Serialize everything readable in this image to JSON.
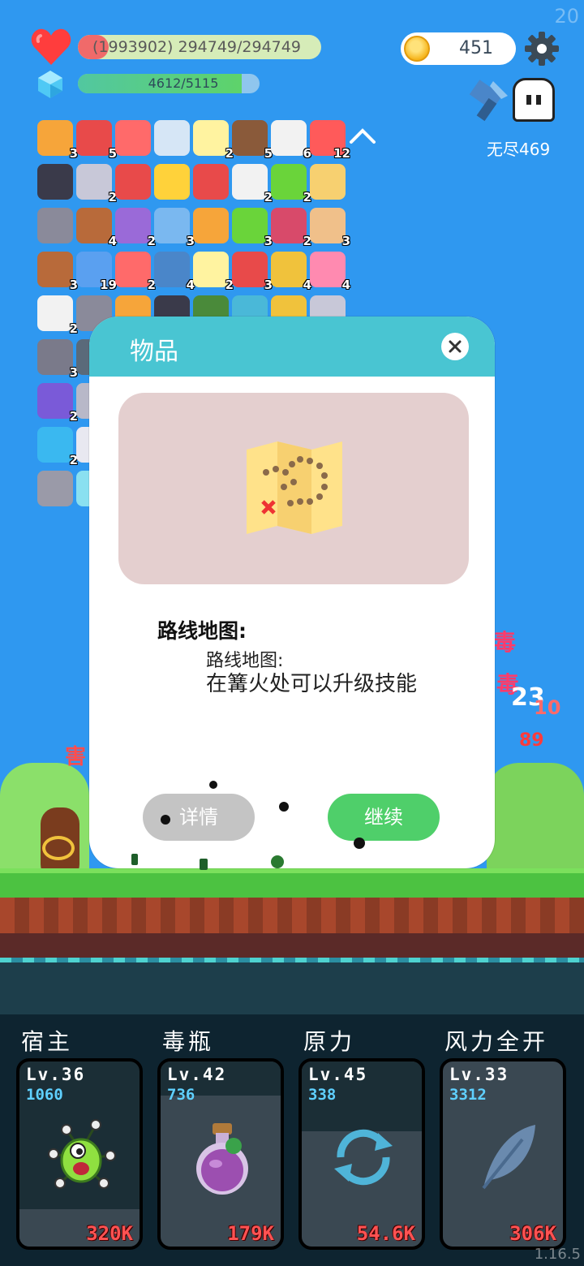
{
  "hud": {
    "fps": "20",
    "hp_text": "(1993902) 294749/294749",
    "mp_text": "4612/5115",
    "mp_fraction": 0.9,
    "coins": "451",
    "mode_label": "无尽469"
  },
  "items": [
    {
      "icon": "book-icon",
      "count": "3"
    },
    {
      "icon": "sock-icon",
      "count": "5"
    },
    {
      "icon": "percent-tag-icon",
      "count": ""
    },
    {
      "icon": "sword-icon",
      "count": ""
    },
    {
      "icon": "flower-icon",
      "count": "2"
    },
    {
      "icon": "coconut-icon",
      "count": "5"
    },
    {
      "icon": "cloud-icon",
      "count": "6"
    },
    {
      "icon": "watermelon-icon",
      "count": "12"
    },
    {
      "icon": "hood-icon",
      "count": ""
    },
    {
      "icon": "tombstone-icon",
      "count": "2"
    },
    {
      "icon": "bookmark-icon",
      "count": ""
    },
    {
      "icon": "sun-icon",
      "count": ""
    },
    {
      "icon": "sneaker-icon",
      "count": ""
    },
    {
      "icon": "clipboard-icon",
      "count": "2"
    },
    {
      "icon": "lime-icon",
      "count": "2"
    },
    {
      "icon": "map-icon",
      "count": ""
    },
    {
      "icon": "helmet-icon",
      "count": ""
    },
    {
      "icon": "round-shield-icon",
      "count": "4"
    },
    {
      "icon": "star-shield-icon",
      "count": "2"
    },
    {
      "icon": "capsule-icon",
      "count": "3"
    },
    {
      "icon": "crown-icon",
      "count": ""
    },
    {
      "icon": "zombie-icon",
      "count": "3"
    },
    {
      "icon": "jam-jar-icon",
      "count": "2"
    },
    {
      "icon": "fist-icon",
      "count": "3"
    },
    {
      "icon": "coconut-drink-icon",
      "count": "3"
    },
    {
      "icon": "star-card-icon",
      "count": "19"
    },
    {
      "icon": "pill-icon",
      "count": "2"
    },
    {
      "icon": "blue-shield-icon",
      "count": "4"
    },
    {
      "icon": "fried-egg-icon",
      "count": "2"
    },
    {
      "icon": "mushroom-icon",
      "count": "3"
    },
    {
      "icon": "halo-mustache-icon",
      "count": "4"
    },
    {
      "icon": "ice-cream-icon",
      "count": "4"
    },
    {
      "icon": "ghost-icon",
      "count": "2"
    },
    {
      "icon": "compass-icon",
      "count": ""
    },
    {
      "icon": "feather-icon",
      "count": ""
    },
    {
      "icon": "bat-icon",
      "count": ""
    },
    {
      "icon": "grenade-icon",
      "count": ""
    },
    {
      "icon": "scroll-icon",
      "count": ""
    },
    {
      "icon": "ring-icon",
      "count": ""
    },
    {
      "icon": "bell-icon",
      "count": ""
    },
    {
      "icon": "cauldron-icon",
      "count": "3"
    },
    {
      "icon": "disc-icon",
      "count": ""
    },
    {
      "icon": "purple-chest-icon",
      "count": "2"
    },
    {
      "icon": "smoke-icon",
      "count": ""
    },
    {
      "icon": "blue-gem-icon",
      "count": "2"
    },
    {
      "icon": "dice-icon",
      "count": ""
    },
    {
      "icon": "glass-pane-icon",
      "count": ""
    },
    {
      "icon": "crystal-icon",
      "count": ""
    }
  ],
  "dialog": {
    "title": "物品",
    "item_name": "路线地图:",
    "item_subtitle": "路线地图:",
    "item_desc": "在篝火处可以升级技能",
    "detail_label": "详情",
    "continue_label": "继续"
  },
  "skills": [
    {
      "name": "宿主",
      "level": "Lv.36",
      "value": "1060",
      "cost": "320K",
      "icon": "virus-monster-icon"
    },
    {
      "name": "毒瓶",
      "level": "Lv.42",
      "value": "736",
      "cost": "179K",
      "icon": "poison-bottle-icon"
    },
    {
      "name": "原力",
      "level": "Lv.45",
      "value": "338",
      "cost": "54.6K",
      "icon": "cycle-arrows-icon"
    },
    {
      "name": "风力全开",
      "level": "Lv.33",
      "value": "3312",
      "cost": "306K",
      "icon": "feather-icon"
    }
  ],
  "version": "1.16.5",
  "colors": {
    "sky": "#2f98f0",
    "dialog_header": "#49c5d2",
    "continue_button": "#4fcf6a",
    "detail_button": "#c4c4c4",
    "hp_fill": "#f06a6a",
    "skill_value": "#5fd0ff",
    "skill_cost": "#ff5252"
  }
}
